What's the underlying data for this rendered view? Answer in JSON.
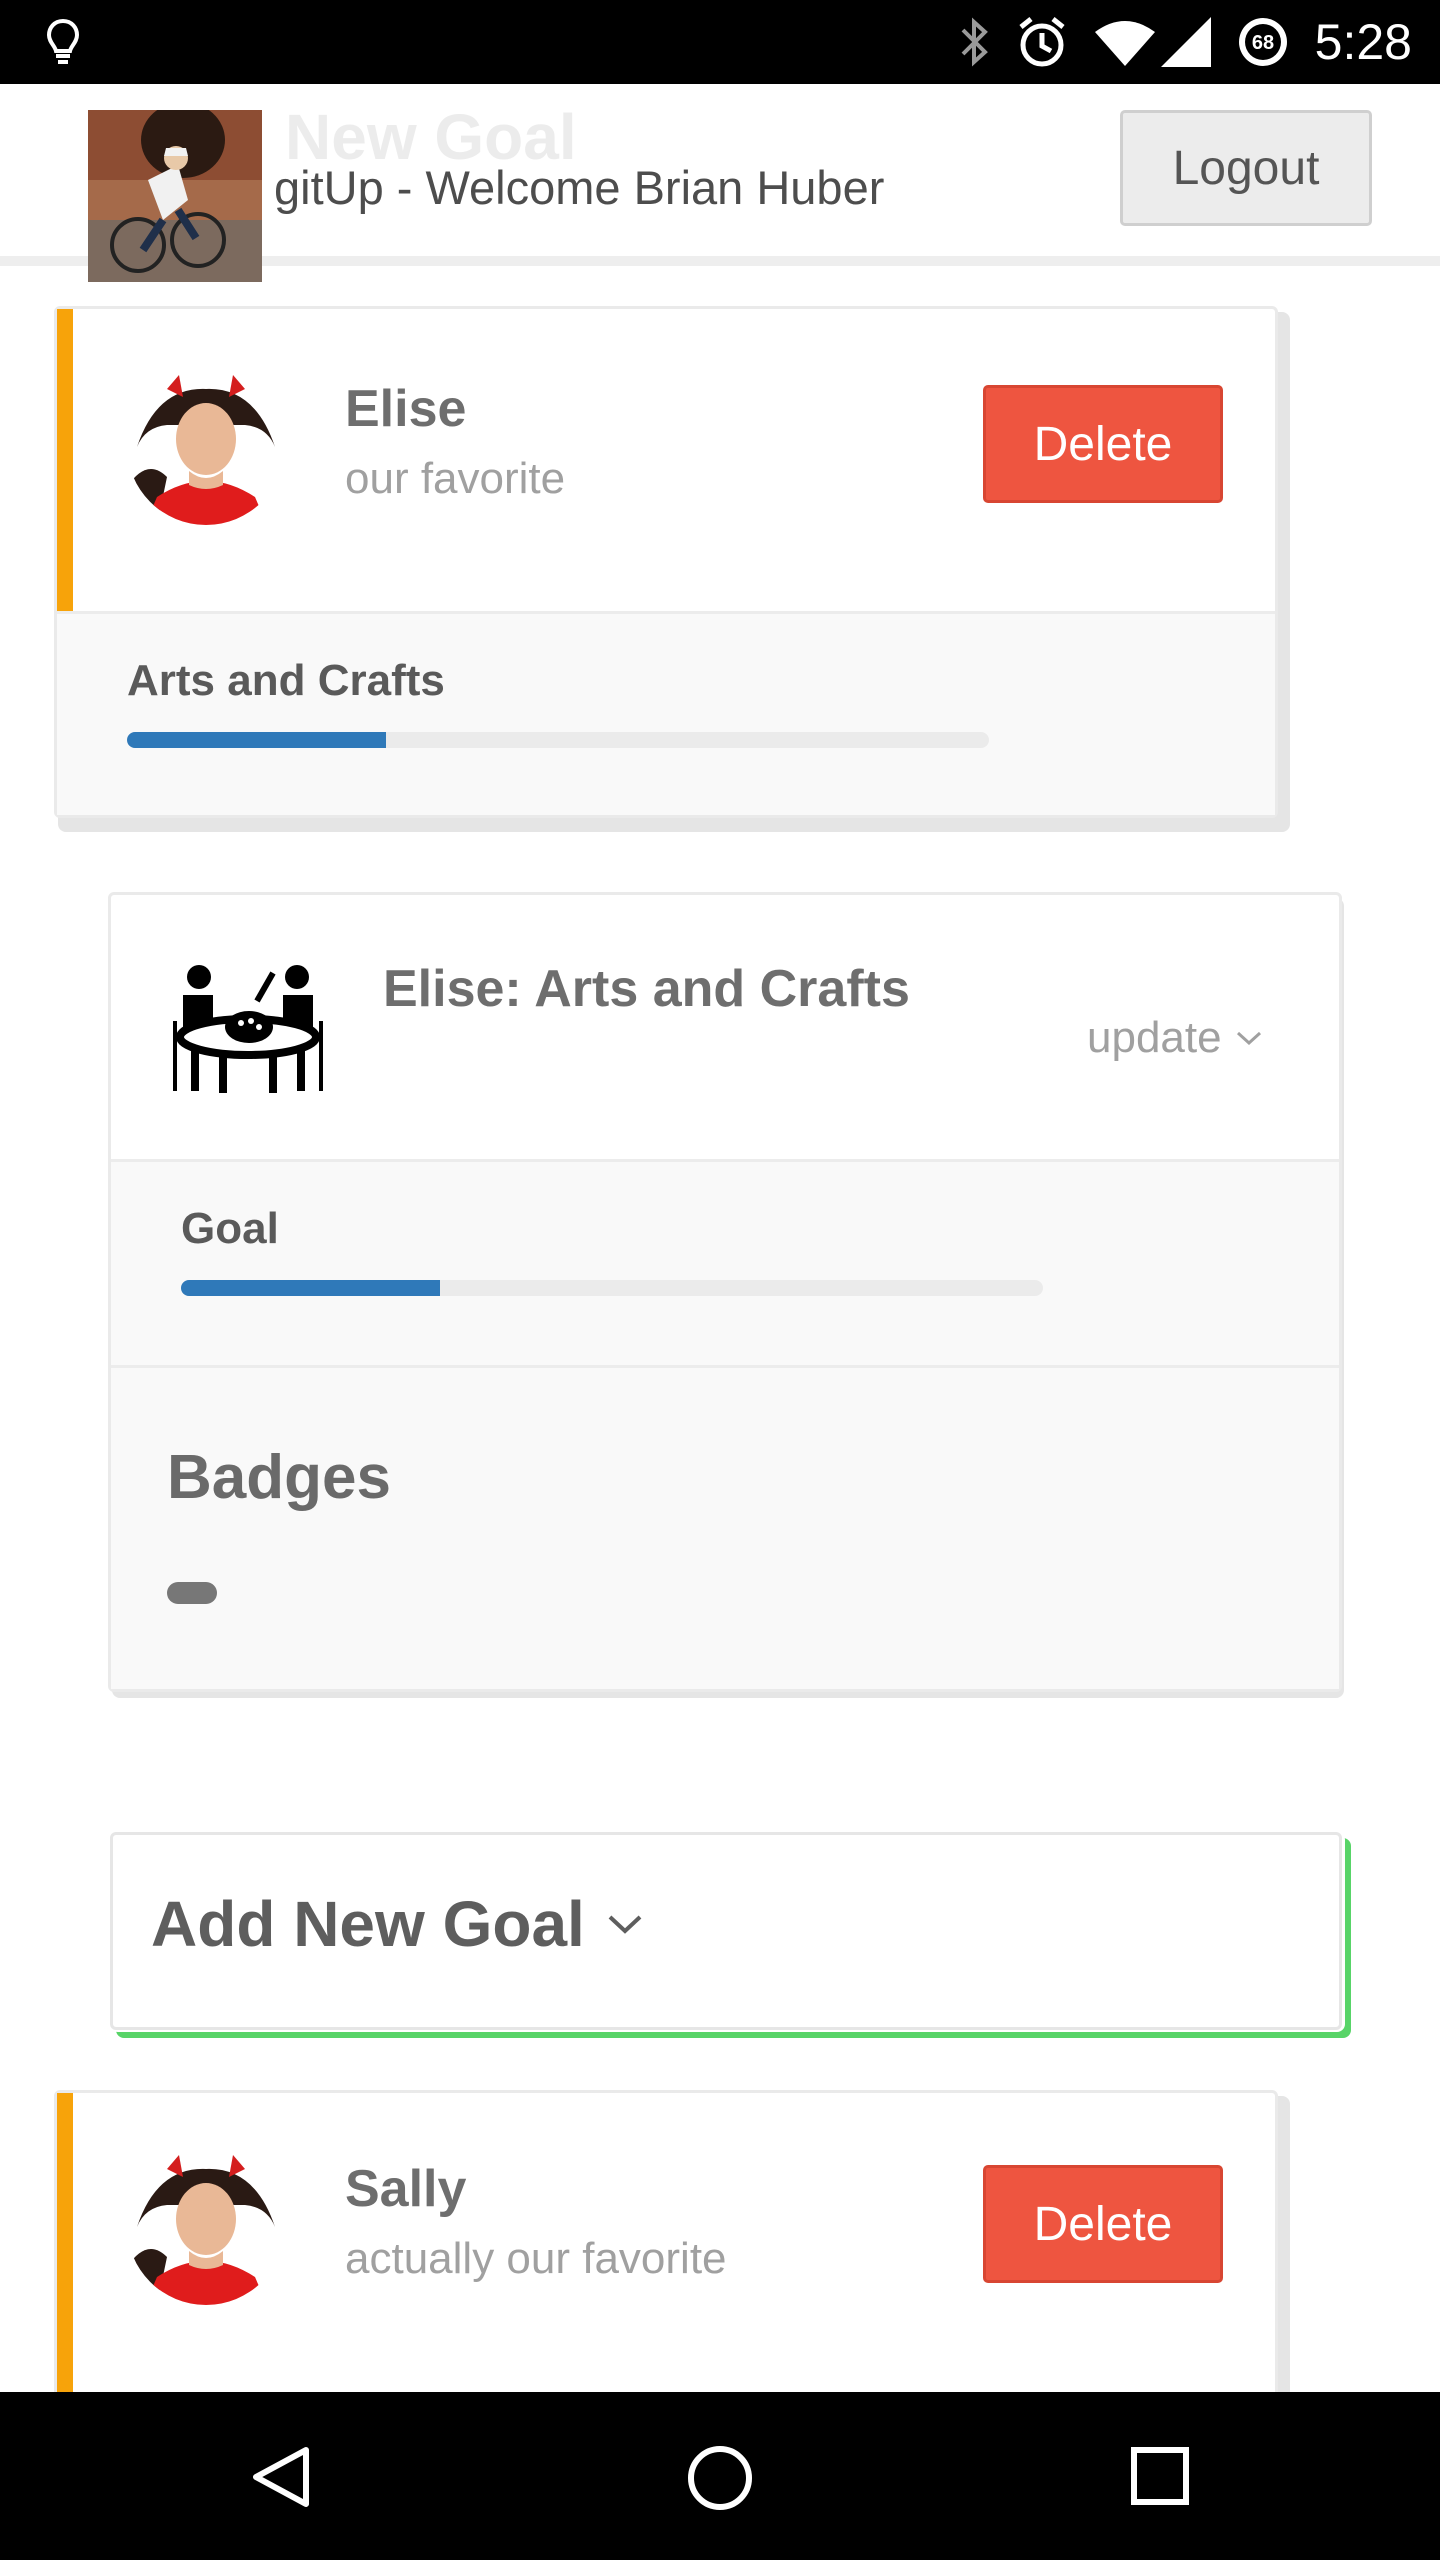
{
  "status_bar": {
    "time": "5:28",
    "battery_level": "68",
    "icons": [
      "lightbulb-icon",
      "bluetooth-icon",
      "alarm-icon",
      "wifi-icon",
      "signal-icon",
      "battery-icon"
    ]
  },
  "header": {
    "background_title": "New Goal",
    "title": "gitUp - Welcome Brian Huber",
    "logout_label": "Logout"
  },
  "children": [
    {
      "name": "Elise",
      "description": "our favorite",
      "delete_label": "Delete",
      "goal": {
        "name": "Arts and Crafts",
        "progress": 0.3
      }
    },
    {
      "name": "Sally",
      "description": "actually our favorite",
      "delete_label": "Delete"
    }
  ],
  "goal_detail": {
    "title": "Elise: Arts and Crafts",
    "update_label": "update",
    "goal_label": "Goal",
    "goal_progress": 0.3,
    "badges_title": "Badges"
  },
  "add_goal": {
    "label": "Add New Goal"
  },
  "colors": {
    "accent_orange": "#f7a30a",
    "delete_red": "#ee5540",
    "progress_blue": "#2f79b9",
    "add_goal_green": "#58d468"
  }
}
